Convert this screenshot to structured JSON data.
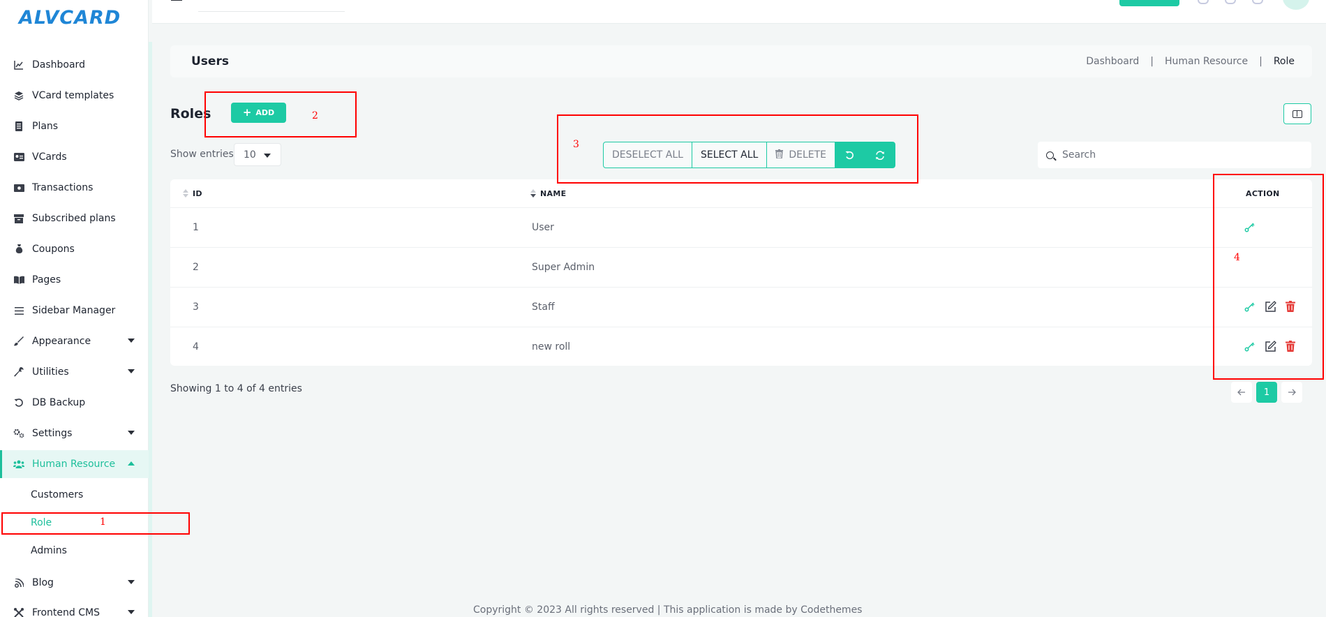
{
  "app": {
    "logo": "ALVCARD"
  },
  "sidebar": {
    "items": [
      {
        "label": "Dashboard",
        "icon": "chart-line-icon",
        "glyph": "📈"
      },
      {
        "label": "VCard templates",
        "icon": "layers-icon",
        "glyph": "◈"
      },
      {
        "label": "Plans",
        "icon": "receipt-icon",
        "glyph": "▤"
      },
      {
        "label": "VCards",
        "icon": "id-card-icon",
        "glyph": "▣"
      },
      {
        "label": "Transactions",
        "icon": "money-bill-icon",
        "glyph": "▬"
      },
      {
        "label": "Subscribed plans",
        "icon": "archive-icon",
        "glyph": "▦"
      },
      {
        "label": "Coupons",
        "icon": "money-bag-icon",
        "glyph": "♁"
      },
      {
        "label": "Pages",
        "icon": "book-open-icon",
        "glyph": "▥"
      },
      {
        "label": "Sidebar Manager",
        "icon": "bars-icon",
        "glyph": "≡"
      },
      {
        "label": "Appearance",
        "icon": "brush-icon",
        "glyph": "✎"
      },
      {
        "label": "Utilities",
        "icon": "wrench-icon",
        "glyph": "⚒"
      },
      {
        "label": "DB Backup",
        "icon": "rotate-left-icon",
        "glyph": "↺"
      },
      {
        "label": "Settings",
        "icon": "gears-icon",
        "glyph": "⚙"
      },
      {
        "label": "Human Resource",
        "icon": "users-icon",
        "glyph": "⚇"
      },
      {
        "label": "Blog",
        "icon": "blog-icon",
        "glyph": "✉"
      },
      {
        "label": "Frontend CMS",
        "icon": "tools-icon",
        "glyph": "✕"
      }
    ],
    "sub_items": [
      "Customers",
      "Role",
      "Admins"
    ]
  },
  "header": {
    "title": "Users",
    "breadcrumb": [
      "Dashboard",
      "Human Resource",
      "Role"
    ],
    "separator": "|"
  },
  "page": {
    "title": "Roles",
    "add_label": "ADD",
    "show_entries_label": "Show entries",
    "entries_value": "10",
    "deselect_all": "DESELECT ALL",
    "select_all": "SELECT ALL",
    "delete": "DELETE",
    "search_placeholder": "Search",
    "showing_text": "Showing 1 to 4 of 4 entries",
    "current_page": "1"
  },
  "table": {
    "headers": {
      "id": "ID",
      "name": "NAME",
      "action": "ACTION"
    },
    "rows": [
      {
        "id": "1",
        "name": "User"
      },
      {
        "id": "2",
        "name": "Super Admin"
      },
      {
        "id": "3",
        "name": "Staff"
      },
      {
        "id": "4",
        "name": "new roll"
      }
    ]
  },
  "footer": {
    "text": "Copyright © 2023 All rights reserved | This application is made by Codethemes"
  },
  "annotations": [
    "1",
    "2",
    "3",
    "4"
  ],
  "colors": {
    "accent": "#1dcaa4",
    "danger": "#e53935",
    "annotation": "#ff0000",
    "logo": "#1f86d6"
  }
}
